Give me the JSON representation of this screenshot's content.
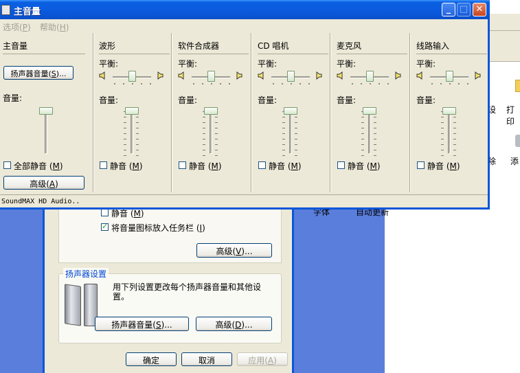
{
  "control_panel": {
    "item_labels": [
      "设",
      "打印",
      "除",
      "添"
    ],
    "bottom_labels": [
      "字体",
      "自动更新"
    ]
  },
  "sound_dialog": {
    "mute_label": "静音",
    "mute_key": "M",
    "taskbar_icon_label": "将音量图标放入任务栏",
    "taskbar_icon_key": "I",
    "advanced_top_label": "高级",
    "advanced_top_key": "V",
    "group_title": "扬声器设置",
    "group_desc_line1": "用下列设置更改每个扬声器音量和其他设",
    "group_desc_line2": "置。",
    "speaker_volume_label": "扬声器音量",
    "speaker_volume_key": "S",
    "advanced_bottom_label": "高级",
    "advanced_bottom_key": "D",
    "ok_label": "确定",
    "cancel_label": "取消",
    "apply_label": "应用",
    "apply_key": "A"
  },
  "mixer": {
    "title": "主音量",
    "menu": [
      {
        "label": "选项",
        "key": "P"
      },
      {
        "label": "帮助",
        "key": "H"
      }
    ],
    "master": {
      "title": "主音量",
      "speaker_button": "扬声器音量",
      "speaker_button_key": "S",
      "volume_label": "音量:",
      "mute_all_label": "全部静音",
      "mute_all_key": "M",
      "advanced_label": "高级",
      "advanced_key": "A",
      "volume_level": 1.0
    },
    "channels": [
      {
        "title": "波形",
        "balance_label": "平衡:",
        "volume_label": "音量:",
        "mute_label": "静音",
        "mute_key": "M",
        "volume_level": 1.0,
        "balance": 0.5
      },
      {
        "title": "软件合成器",
        "balance_label": "平衡:",
        "volume_label": "音量:",
        "mute_label": "静音",
        "mute_key": "M",
        "volume_level": 1.0,
        "balance": 0.5
      },
      {
        "title": "CD 唱机",
        "balance_label": "平衡:",
        "volume_label": "音量:",
        "mute_label": "静音",
        "mute_key": "M",
        "volume_level": 1.0,
        "balance": 0.5
      },
      {
        "title": "麦克风",
        "balance_label": "平衡:",
        "volume_label": "音量:",
        "mute_label": "静音",
        "mute_key": "M",
        "volume_level": 1.0,
        "balance": 0.5
      },
      {
        "title": "线路输入",
        "balance_label": "平衡:",
        "volume_label": "音量:",
        "mute_label": "静音",
        "mute_key": "M",
        "volume_level": 1.0,
        "balance": 0.5
      }
    ],
    "status_text": "SoundMAX HD Audio.."
  }
}
